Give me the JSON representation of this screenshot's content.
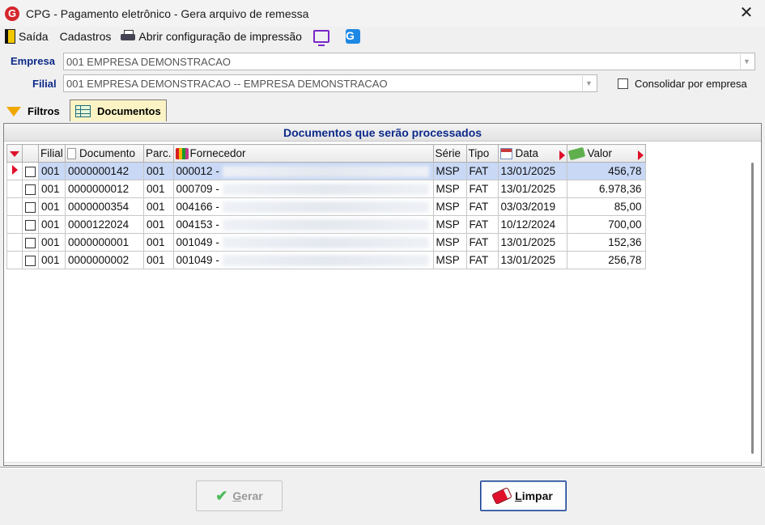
{
  "window": {
    "app_logo": "G",
    "title": "CPG -  Pagamento eletrônico - Gera arquivo de remessa",
    "close_glyph": "✕"
  },
  "menu": [
    {
      "label": "Saída",
      "icon": "exit-door-icon"
    },
    {
      "label": "Cadastros",
      "icon": ""
    },
    {
      "label": "Abrir configuração de impressão",
      "icon": "printer-icon"
    }
  ],
  "menu_icons": {
    "screen": "monitor-icon",
    "g_app": "g-app-icon",
    "g_app_text": "G"
  },
  "form": {
    "empresa_label": "Empresa",
    "empresa_value": "001 EMPRESA DEMONSTRACAO",
    "filial_label": "Filial",
    "filial_value": "001 EMPRESA DEMONSTRACAO -- EMPRESA DEMONSTRACAO",
    "consolidar_label": "Consolidar por empresa",
    "consolidar_checked": false,
    "combo_arrow": "▼"
  },
  "tabs": {
    "filtros": "Filtros",
    "documentos": "Documentos",
    "active": "Documentos"
  },
  "panel": {
    "caption": "Documentos que serão processados"
  },
  "grid": {
    "columns": {
      "filial": "Filial",
      "documento": "Documento",
      "parc": "Parc.",
      "fornecedor": "Fornecedor",
      "serie": "Série",
      "tipo": "Tipo",
      "data": "Data",
      "valor": "Valor"
    },
    "rows": [
      {
        "filial": "001",
        "documento": "0000000142",
        "parc": "001",
        "fornecedor": "000012 -",
        "serie": "MSP",
        "tipo": "FAT",
        "data": "13/01/2025",
        "valor": "456,78",
        "selected": true
      },
      {
        "filial": "001",
        "documento": "0000000012",
        "parc": "001",
        "fornecedor": "000709 -",
        "serie": "MSP",
        "tipo": "FAT",
        "data": "13/01/2025",
        "valor": "6.978,36",
        "selected": false
      },
      {
        "filial": "001",
        "documento": "0000000354",
        "parc": "001",
        "fornecedor": "004166 -",
        "serie": "MSP",
        "tipo": "FAT",
        "data": "03/03/2019",
        "valor": "85,00",
        "selected": false
      },
      {
        "filial": "001",
        "documento": "0000122024",
        "parc": "001",
        "fornecedor": "004153 -",
        "serie": "MSP",
        "tipo": "FAT",
        "data": "10/12/2024",
        "valor": "700,00",
        "selected": false
      },
      {
        "filial": "001",
        "documento": "0000000001",
        "parc": "001",
        "fornecedor": "001049 -",
        "serie": "MSP",
        "tipo": "FAT",
        "data": "13/01/2025",
        "valor": "152,36",
        "selected": false
      },
      {
        "filial": "001",
        "documento": "0000000002",
        "parc": "001",
        "fornecedor": "001049 -",
        "serie": "MSP",
        "tipo": "FAT",
        "data": "13/01/2025",
        "valor": "256,78",
        "selected": false
      }
    ]
  },
  "buttons": {
    "gerar": "Gerar",
    "limpar": "Limpar",
    "gerar_enabled": false
  }
}
